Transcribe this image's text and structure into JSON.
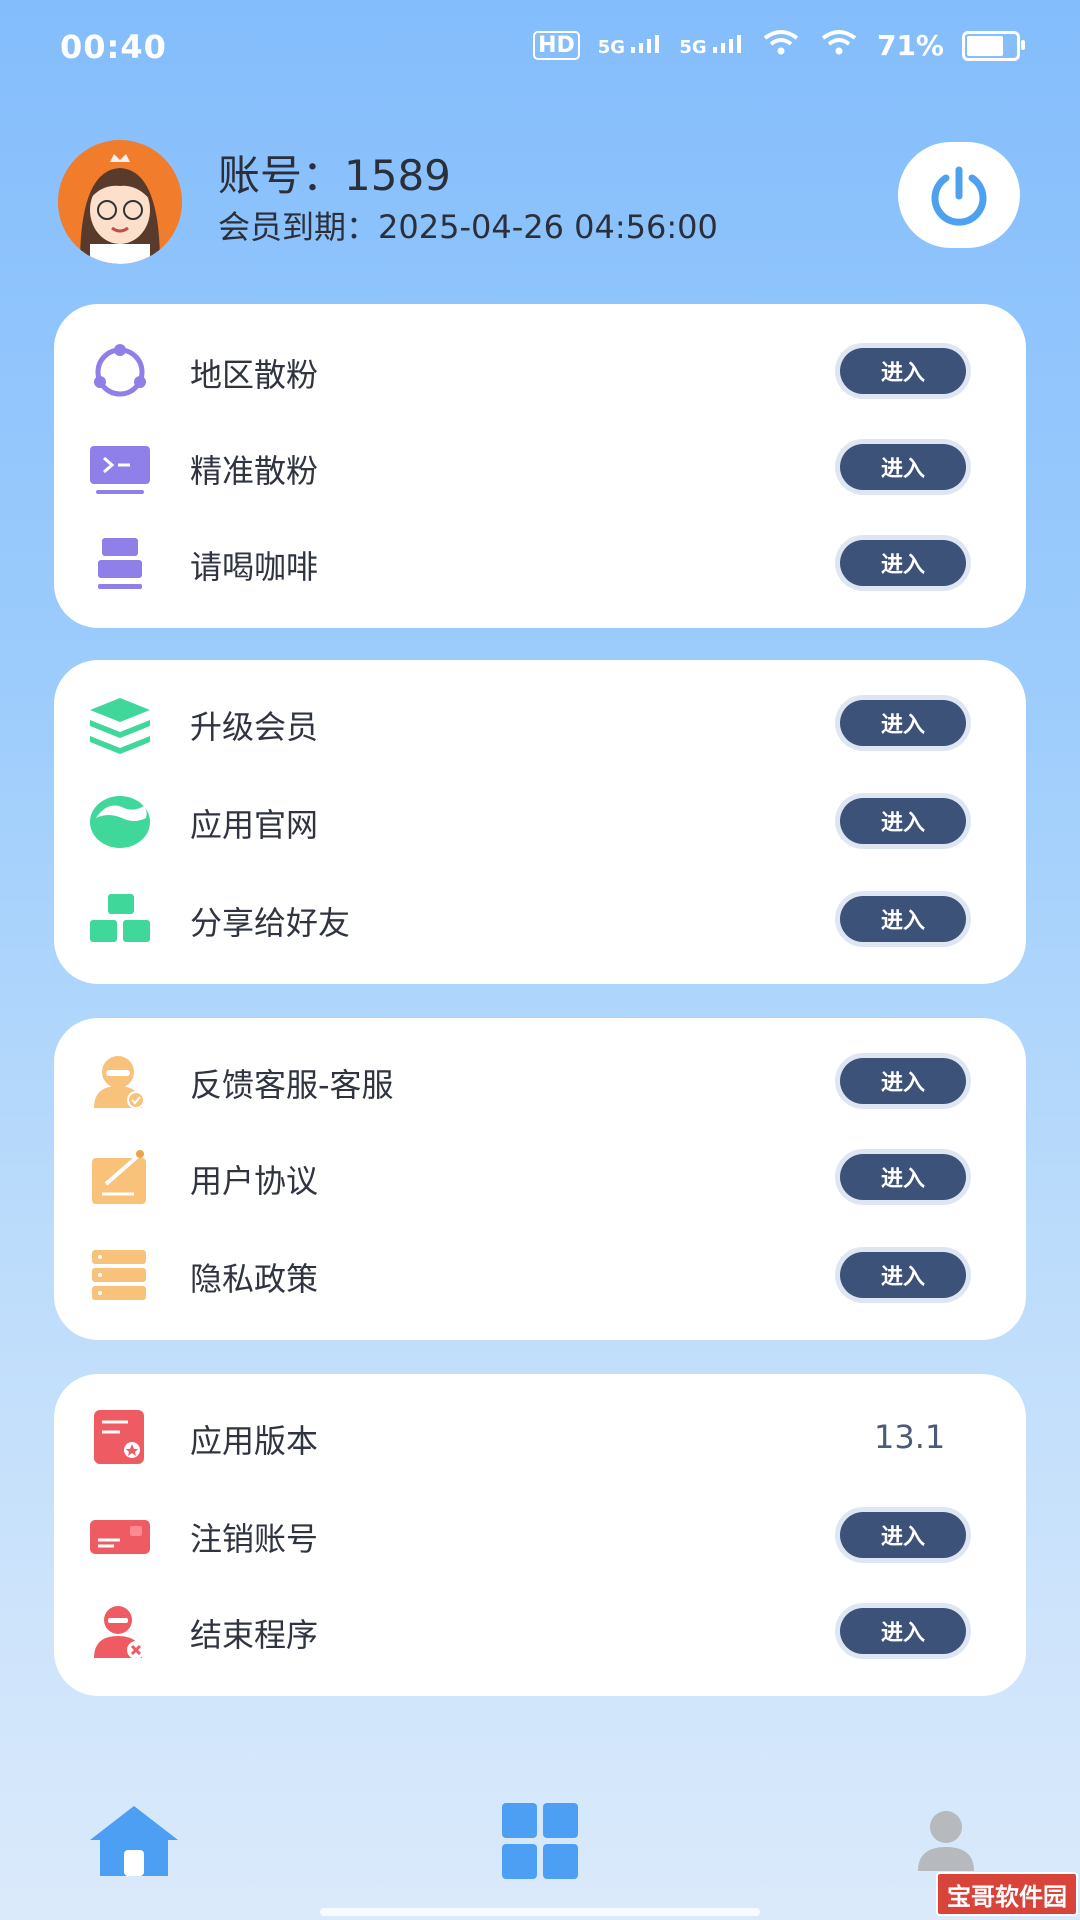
{
  "status_bar": {
    "time": "00:40",
    "network_hd": "HD",
    "network_5g_1": "5G",
    "network_5g_2": "5G",
    "battery": "71%"
  },
  "profile": {
    "account": "账号：1589",
    "expiry": "会员到期：2025-04-26 04:56:00"
  },
  "groups": [
    {
      "items": [
        {
          "label": "地区散粉",
          "action": "进入",
          "icon": "circle-nodes-icon"
        },
        {
          "label": "精准散粉",
          "action": "进入",
          "icon": "terminal-icon"
        },
        {
          "label": "请喝咖啡",
          "action": "进入",
          "icon": "stack-icon"
        }
      ]
    },
    {
      "items": [
        {
          "label": "升级会员",
          "action": "进入",
          "icon": "layers-icon"
        },
        {
          "label": "应用官网",
          "action": "进入",
          "icon": "wave-icon"
        },
        {
          "label": "分享给好友",
          "action": "进入",
          "icon": "blocks-icon"
        }
      ]
    },
    {
      "items": [
        {
          "label": "反馈客服-客服",
          "action": "进入",
          "icon": "support-icon"
        },
        {
          "label": "用户协议",
          "action": "进入",
          "icon": "agreement-icon"
        },
        {
          "label": "隐私政策",
          "action": "进入",
          "icon": "list-icon"
        }
      ]
    },
    {
      "items": [
        {
          "label": "应用版本",
          "value": "13.1",
          "icon": "version-icon"
        },
        {
          "label": "注销账号",
          "action": "进入",
          "icon": "card-icon"
        },
        {
          "label": "结束程序",
          "action": "进入",
          "icon": "exit-user-icon"
        }
      ]
    }
  ],
  "tabbar": {
    "home": "home-icon",
    "apps": "grid-icon",
    "profile": "user-icon"
  },
  "watermark": "宝哥软件园",
  "colors": {
    "enter_button": "#3c5278",
    "purple_icon": "#8f7fe8",
    "green_icon": "#3fd79a",
    "orange_icon": "#f8c27a",
    "red_icon": "#ee5b62",
    "tab_icon": "#4c9ff2"
  }
}
